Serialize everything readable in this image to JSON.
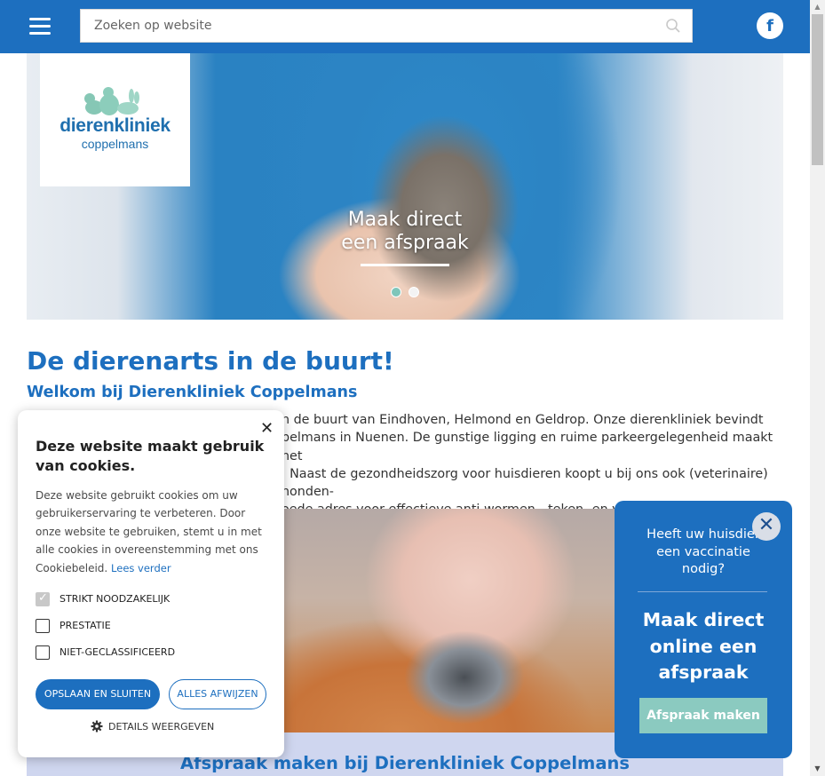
{
  "header": {
    "menu_icon": "hamburger-menu-icon",
    "search_placeholder": "Zoeken op website",
    "search_icon": "search-icon",
    "facebook_label": "f",
    "accent_color": "#1d6fbf"
  },
  "hero": {
    "logo_name": "dierenkliniek",
    "logo_sub": "coppelmans",
    "caption_line1": "Maak direct",
    "caption_line2": "een afspraak",
    "slides": 2,
    "active_slide": 1
  },
  "main": {
    "title": "De dierenarts in de buurt!",
    "subtitle": "Welkom bij Dierenkliniek Coppelmans",
    "intro_lines": [
      "n de buurt van Eindhoven, Helmond en Geldrop. Onze dierenkliniek bevindt",
      "pelmans in Nuenen. De gunstige ligging en ruime parkeergelegenheid maakt het",
      ". Naast de gezondheidszorg voor huisdieren koopt u bij ons ook (veterinaire) honden-",
      "oede adres voor effectieve anti wormen-, teken- en vlooienproducten."
    ],
    "band_title": "Afspraak maken bij Dierenkliniek Coppelmans"
  },
  "cookie": {
    "close": "✕",
    "title": "Deze website maakt gebruik van cookies.",
    "text": "Deze website gebruikt cookies om uw gebruikerservaring te verbeteren. Door onze website te gebruiken, stemt u in met alle cookies in overeenstemming met ons Cookiebeleid.",
    "link": "Lees verder",
    "options": [
      {
        "label": "STRIKT NOODZAKELIJK",
        "checked": true
      },
      {
        "label": "PRESTATIE",
        "checked": false
      },
      {
        "label": "NIET-GECLASSIFICEERD",
        "checked": false
      }
    ],
    "save_button": "OPSLAAN EN SLUITEN",
    "reject_button": "ALLES AFWIJZEN",
    "details": "DETAILS WEERGEVEN"
  },
  "appointment": {
    "close": "✕",
    "question": "Heeft uw huisdier een vaccinatie nodig?",
    "heading": "Maak direct online een afspraak",
    "button": "Afspraak maken",
    "button_color": "#8bcac0"
  }
}
